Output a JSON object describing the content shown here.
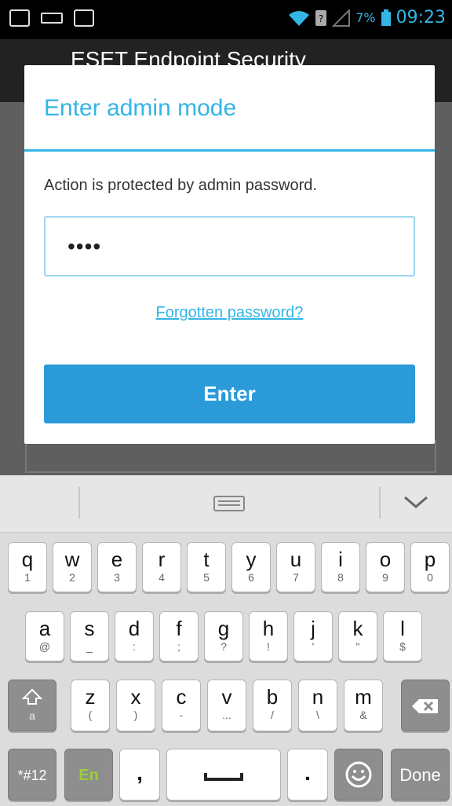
{
  "status_bar": {
    "battery_percent": "7%",
    "time": "09:23"
  },
  "app": {
    "title": "ESET Endpoint Security"
  },
  "dialog": {
    "title": "Enter admin mode",
    "message": "Action is protected by admin password.",
    "password_value": "••••",
    "forgot_link": "Forgotten password?",
    "enter_button": "Enter"
  },
  "keyboard": {
    "row1": [
      {
        "main": "q",
        "sub": "1"
      },
      {
        "main": "w",
        "sub": "2"
      },
      {
        "main": "e",
        "sub": "3"
      },
      {
        "main": "r",
        "sub": "4"
      },
      {
        "main": "t",
        "sub": "5"
      },
      {
        "main": "y",
        "sub": "6"
      },
      {
        "main": "u",
        "sub": "7"
      },
      {
        "main": "i",
        "sub": "8"
      },
      {
        "main": "o",
        "sub": "9"
      },
      {
        "main": "p",
        "sub": "0"
      }
    ],
    "row2": [
      {
        "main": "a",
        "sub": "@"
      },
      {
        "main": "s",
        "sub": "_"
      },
      {
        "main": "d",
        "sub": ":"
      },
      {
        "main": "f",
        "sub": ";"
      },
      {
        "main": "g",
        "sub": "?"
      },
      {
        "main": "h",
        "sub": "!"
      },
      {
        "main": "j",
        "sub": "'"
      },
      {
        "main": "k",
        "sub": "\""
      },
      {
        "main": "l",
        "sub": "$"
      }
    ],
    "row3": [
      {
        "main": "z",
        "sub": "("
      },
      {
        "main": "x",
        "sub": ")"
      },
      {
        "main": "c",
        "sub": "-"
      },
      {
        "main": "v",
        "sub": "..."
      },
      {
        "main": "b",
        "sub": "/"
      },
      {
        "main": "n",
        "sub": "\\"
      },
      {
        "main": "m",
        "sub": "&"
      }
    ],
    "shift_sub": "a",
    "sym_label": "*#12",
    "lang_label": "En",
    "comma_label": ",",
    "period_label": ".",
    "done_label": "Done",
    "lang_color": "#9ccc3c"
  }
}
